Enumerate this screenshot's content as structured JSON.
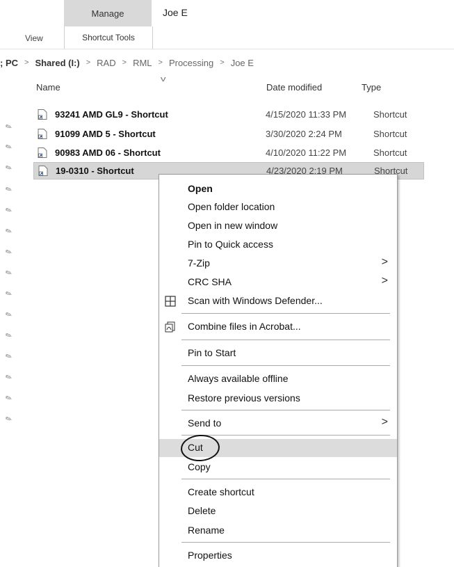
{
  "ribbon": {
    "manage_tab": "Manage",
    "title": "Joe E",
    "view_tab": "View",
    "tools_tab": "Shortcut Tools"
  },
  "breadcrumb": [
    {
      "label": "; PC",
      "bold": true
    },
    {
      "label": "Shared (I:)",
      "bold": true
    },
    {
      "label": "RAD",
      "bold": false
    },
    {
      "label": "RML",
      "bold": false
    },
    {
      "label": "Processing",
      "bold": false
    },
    {
      "label": "Joe E",
      "bold": false
    }
  ],
  "columns": {
    "name": "Name",
    "date": "Date modified",
    "type": "Type"
  },
  "files": [
    {
      "name": "93241 AMD GL9 - Shortcut",
      "date": "4/15/2020 11:33 PM",
      "type": "Shortcut",
      "selected": false
    },
    {
      "name": "91099 AMD 5 - Shortcut",
      "date": "3/30/2020 2:24 PM",
      "type": "Shortcut",
      "selected": false
    },
    {
      "name": "90983 AMD 06 - Shortcut",
      "date": "4/10/2020 11:22 PM",
      "type": "Shortcut",
      "selected": false
    },
    {
      "name": "19-0310 - Shortcut",
      "date": "4/23/2020 2:19 PM",
      "type": "Shortcut",
      "selected": true
    }
  ],
  "menu": {
    "open": "Open",
    "open_folder_location": "Open folder location",
    "open_new_window": "Open in new window",
    "pin_quick_access": "Pin to Quick access",
    "seven_zip": "7-Zip",
    "crc_sha": "CRC SHA",
    "scan_defender": "Scan with Windows Defender...",
    "combine_acrobat": "Combine files in Acrobat...",
    "pin_start": "Pin to Start",
    "always_offline": "Always available offline",
    "restore_versions": "Restore previous versions",
    "send_to": "Send to",
    "cut": "Cut",
    "copy": "Copy",
    "create_shortcut": "Create shortcut",
    "delete": "Delete",
    "rename": "Rename",
    "properties": "Properties",
    "submenu_glyph": ">"
  },
  "icons": {
    "file": "shortcut-file-icon",
    "pin": "pin-icon",
    "defender": "defender-icon",
    "acrobat": "acrobat-icon"
  }
}
